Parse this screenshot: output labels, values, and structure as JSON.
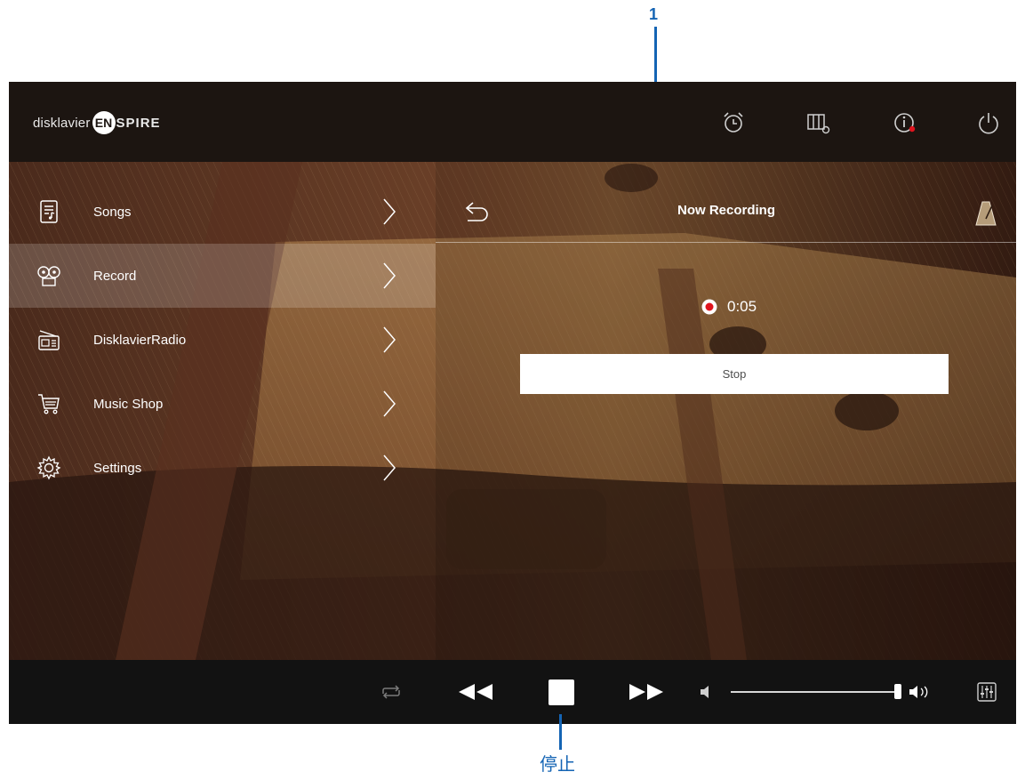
{
  "app": {
    "logo_word1": "disklavier",
    "logo_en": "EN",
    "logo_word2": "SPIRE"
  },
  "top_icons": [
    "alarm-icon",
    "piano-settings-icon",
    "info-icon",
    "power-icon"
  ],
  "menu": {
    "items": [
      {
        "label": "Songs",
        "icon": "songs-icon",
        "active": false
      },
      {
        "label": "Record",
        "icon": "record-tape-icon",
        "active": true
      },
      {
        "label": "DisklavierRadio",
        "icon": "radio-icon",
        "active": false
      },
      {
        "label": "Music Shop",
        "icon": "cart-icon",
        "active": false
      },
      {
        "label": "Settings",
        "icon": "gear-icon",
        "active": false
      }
    ]
  },
  "recording_panel": {
    "title": "Now Recording",
    "elapsed": "0:05",
    "stop_label": "Stop"
  },
  "transport": {
    "icons": [
      "repeat-icon",
      "rewind-icon",
      "stop-icon",
      "fast-forward-icon",
      "volume-low-icon",
      "volume-high-icon",
      "mixer-icon"
    ],
    "volume_level": 1.0
  },
  "annotations": {
    "top_number": "1",
    "bottom_label": "停止"
  },
  "colors": {
    "annotation_blue": "#1464b4",
    "record_red": "#e0141e"
  }
}
